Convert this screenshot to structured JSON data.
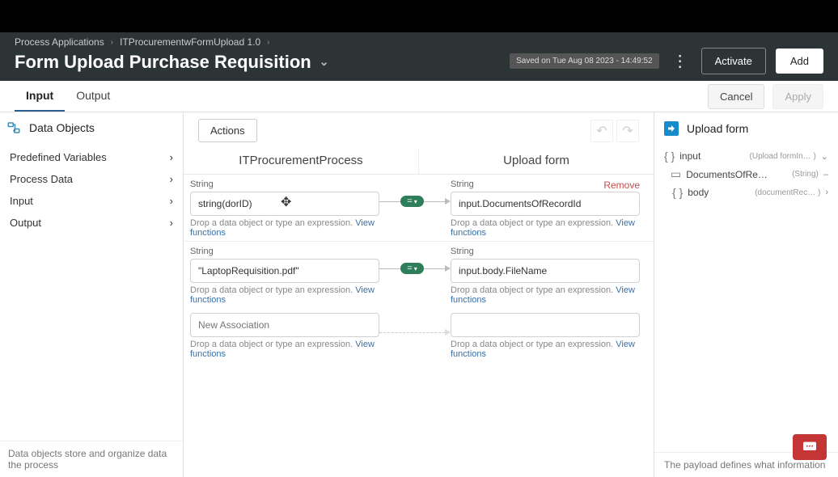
{
  "breadcrumb": {
    "a": "Process Applications",
    "b": "ITProcurementwFormUpload 1.0"
  },
  "title": "Form Upload Purchase Requisition",
  "save_status": "Saved on Tue Aug 08 2023 - 14:49:52",
  "header_buttons": {
    "activate": "Activate",
    "add": "Add"
  },
  "tabs": {
    "input": "Input",
    "output": "Output"
  },
  "subheader_buttons": {
    "cancel": "Cancel",
    "apply": "Apply"
  },
  "sidebar_left": {
    "title": "Data Objects",
    "items": [
      "Predefined Variables",
      "Process Data",
      "Input",
      "Output"
    ],
    "help": "Data objects store and organize data the process"
  },
  "center": {
    "actions_btn": "Actions",
    "col_left": "ITProcurementProcess",
    "col_right": "Upload form",
    "hint_text": "Drop a data object or type an expression.",
    "view_functions": "View functions",
    "remove": "Remove",
    "rows": [
      {
        "type_l": "String",
        "val_l": "string(dorID)",
        "type_r": "String",
        "val_r": "input.DocumentsOfRecordId"
      },
      {
        "type_l": "String",
        "val_l": "\"LaptopRequisition.pdf\"",
        "type_r": "String",
        "val_r": "input.body.FileName"
      }
    ],
    "new_assoc": "New Association"
  },
  "sidebar_right": {
    "title": "Upload form",
    "help": "The payload defines what information",
    "tree": {
      "root": {
        "label": "input",
        "tag": "(Upload formIn… )"
      },
      "n1": {
        "label": "DocumentsOfRe…",
        "tag": "(String)"
      },
      "n2": {
        "label": "body",
        "tag": "(documentRec… )"
      }
    }
  }
}
